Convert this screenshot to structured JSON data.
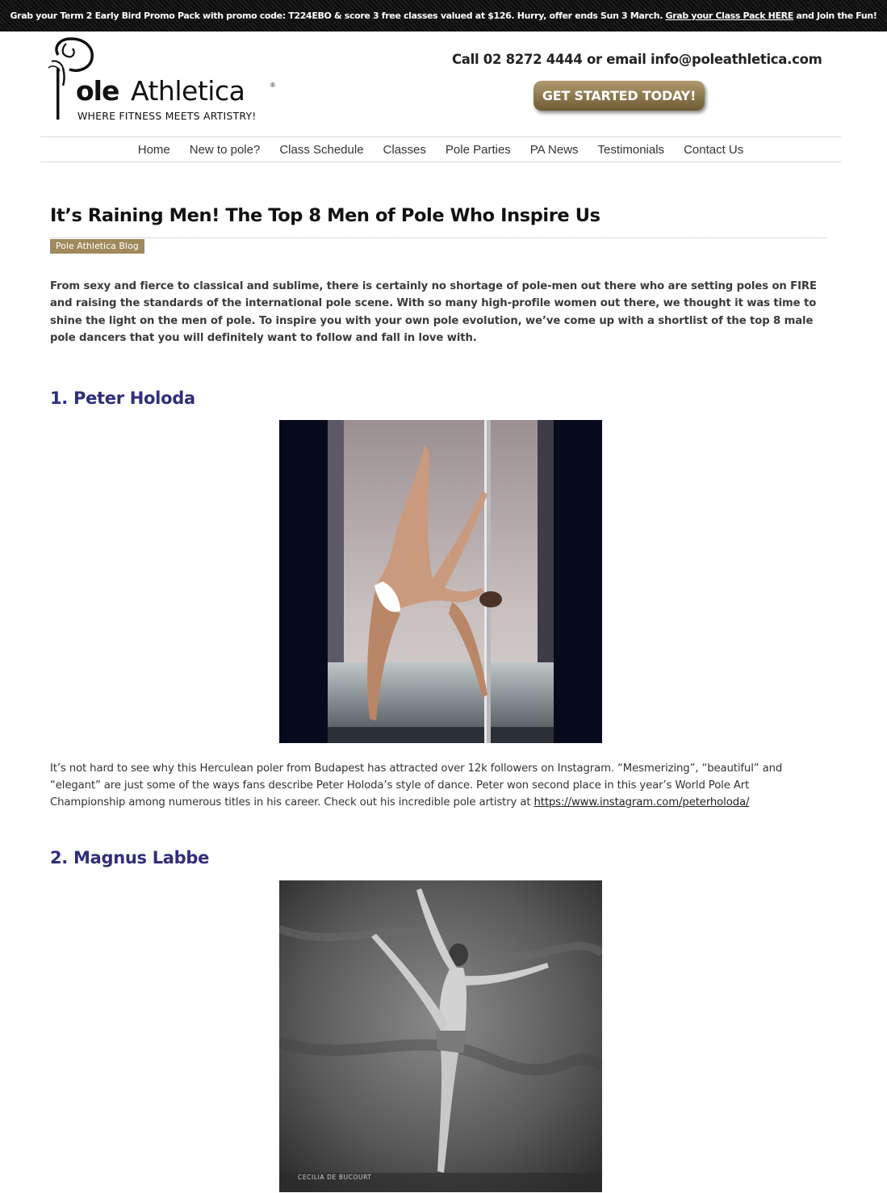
{
  "promo": {
    "text": "Grab your Term 2 Early Bird Promo Pack with promo code: T224EBO & score 3 free classes valued at $126. Hurry, offer ends Sun 3 March.",
    "link_text": "Grab your Class Pack HERE",
    "text_after": "and Join the Fun!"
  },
  "header": {
    "logo_letter": "P",
    "logo_ole": "ole",
    "logo_athletica": "Athletica",
    "logo_reg": "®",
    "logo_tagline": "WHERE FITNESS MEETS ARTISTRY!",
    "contact": "Call 02 8272 4444 or email info@poleathletica.com",
    "cta_label": "GET STARTED TODAY!"
  },
  "nav": {
    "items": [
      "Home",
      "New to pole?",
      "Class Schedule",
      "Classes",
      "Pole Parties",
      "PA News",
      "Testimonials",
      "Contact Us"
    ]
  },
  "post": {
    "title": "It’s Raining Men! The Top 8 Men of Pole Who Inspire Us",
    "category": "Pole Athletica Blog",
    "intro": "From sexy and fierce to classical and sublime, there is certainly no shortage of pole-men out there who are setting poles on FIRE and raising the standards of the international pole scene.   With so many high-profile women out there, we thought it was time to shine the light on the men of pole.  To inspire you with your own pole evolution, we’ve come up with a shortlist of the top 8 male pole dancers that you will definitely want to follow and fall in love with.",
    "sections": [
      {
        "heading": "1. Peter Holoda",
        "body": "It’s not hard to see why this Herculean poler from Budapest has attracted over 12k followers on Instagram. “Mesmerizing”, “beautiful” and “elegant” are just some of the ways fans describe Peter Holoda’s style of dance. Peter won second place in this year’s World Pole Art Championship among numerous titles in his career. Check out his incredible pole artistry at",
        "link": "https://www.instagram.com/peterholoda/"
      },
      {
        "heading": "2. Magnus Labbe",
        "photo_credit": "CECILIA DE BUCOURT"
      }
    ]
  }
}
